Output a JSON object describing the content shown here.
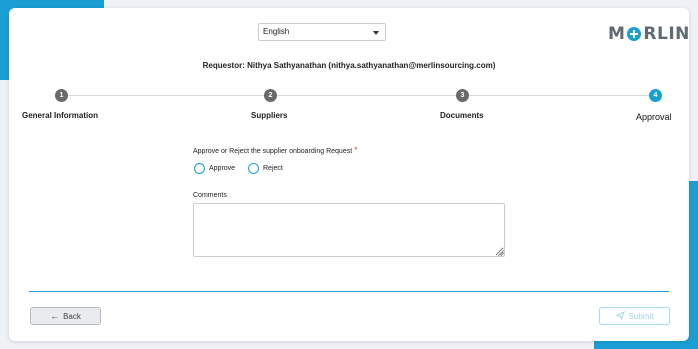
{
  "language_select": {
    "value": "English"
  },
  "logo": {
    "text_left": "M",
    "text_right": "RLIN"
  },
  "requestor_text": "Requestor: Nithya Sathyanathan (nithya.sathyanathan@merlinsourcing.com)",
  "steps": [
    {
      "number": "1",
      "label": "General Information"
    },
    {
      "number": "2",
      "label": "Suppliers"
    },
    {
      "number": "3",
      "label": "Documents"
    },
    {
      "number": "4",
      "label": "Approval"
    }
  ],
  "active_step": 4,
  "form": {
    "question": "Approve or Reject the supplier onboarding Request",
    "required_mark": "*",
    "options": [
      "Approve",
      "Reject"
    ],
    "comments_label": "Comments",
    "comments_value": ""
  },
  "buttons": {
    "back_label": "Back",
    "back_icon": "arrow-left-icon",
    "submit_label": "Submit",
    "submit_icon": "paper-plane-icon"
  },
  "colors": {
    "accent": "#1a9fd4",
    "step_inactive": "#6a6a6a",
    "required": "#d9534f"
  }
}
